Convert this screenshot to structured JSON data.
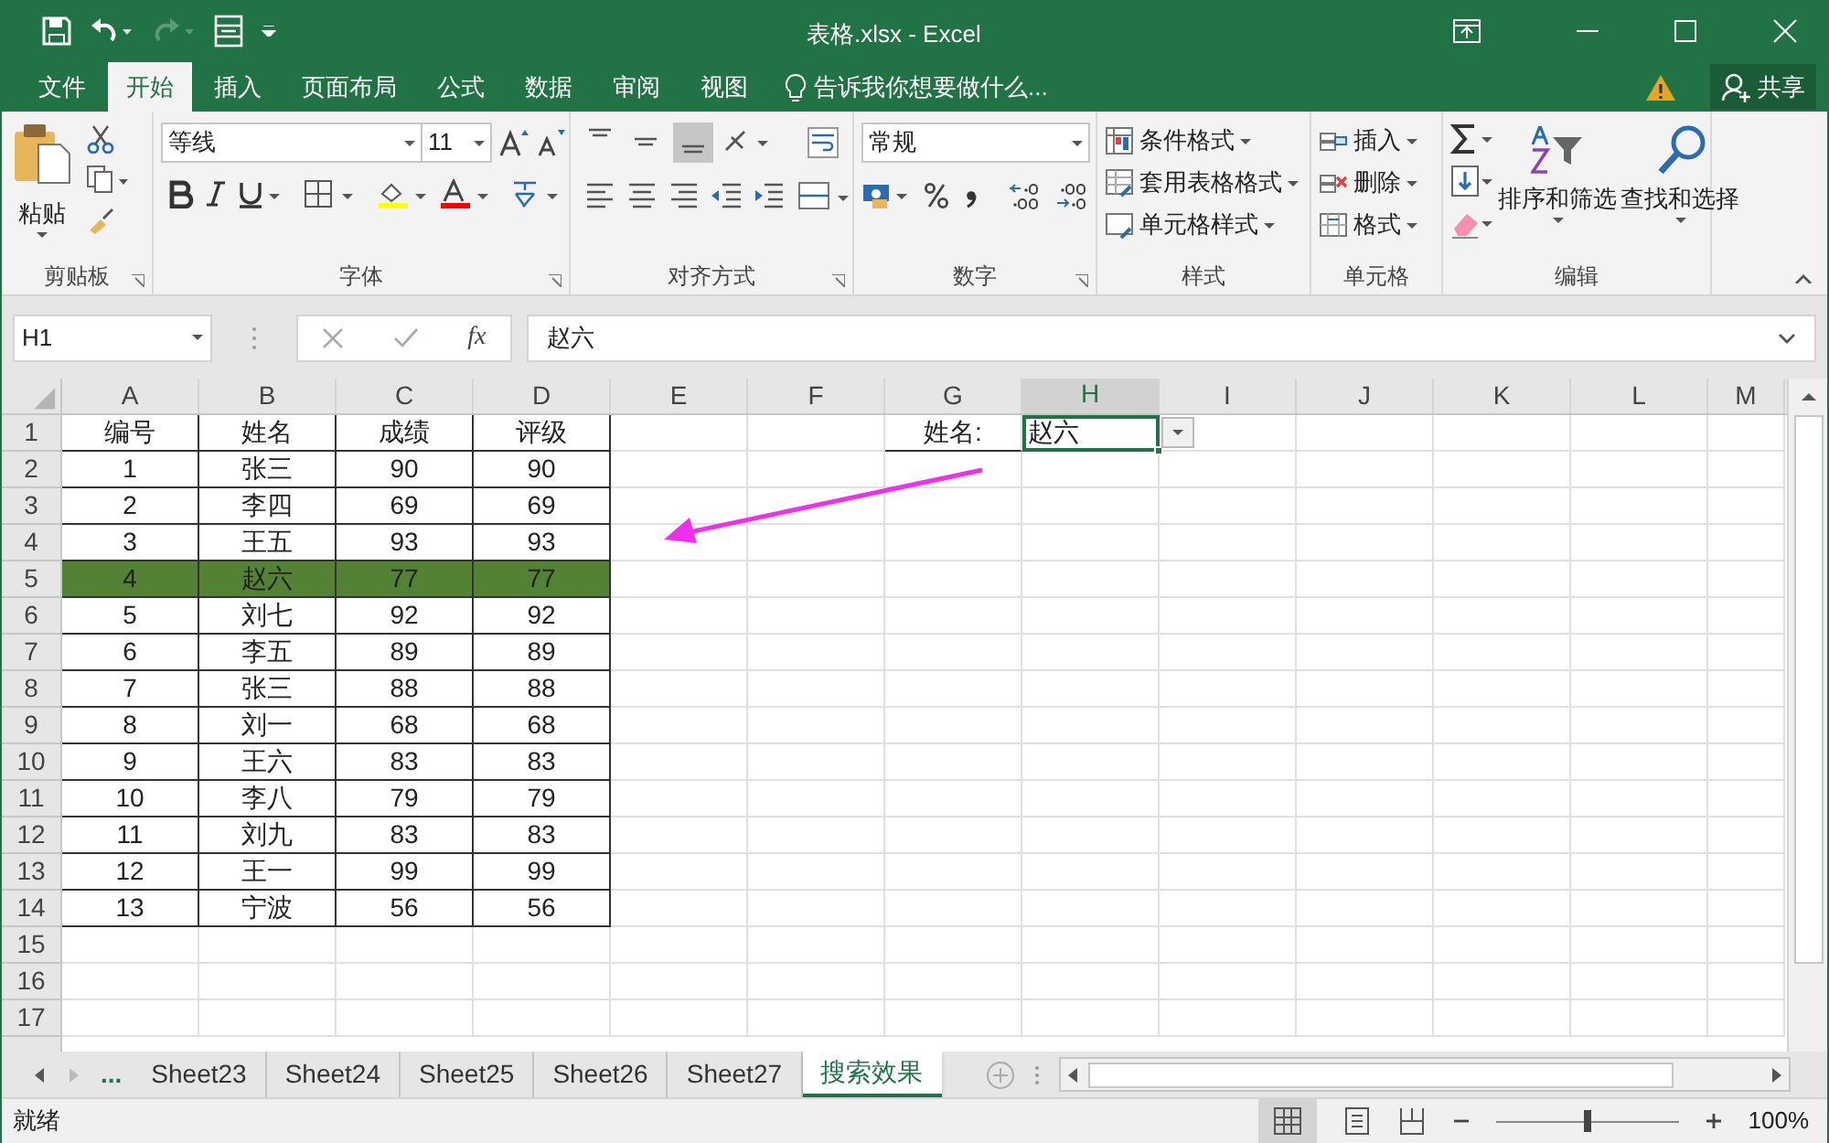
{
  "window": {
    "title": "表格.xlsx - Excel"
  },
  "ribbon_tabs": [
    {
      "label": "文件",
      "selected": false
    },
    {
      "label": "开始",
      "selected": true
    },
    {
      "label": "插入",
      "selected": false
    },
    {
      "label": "页面布局",
      "selected": false
    },
    {
      "label": "公式",
      "selected": false
    },
    {
      "label": "数据",
      "selected": false
    },
    {
      "label": "审阅",
      "selected": false
    },
    {
      "label": "视图",
      "selected": false
    }
  ],
  "tell_me": "告诉我你想要做什么...",
  "share": "共享",
  "ribbon": {
    "clipboard": {
      "label": "剪贴板",
      "paste": "粘贴"
    },
    "font": {
      "label": "字体",
      "font_name": "等线",
      "font_size": "11"
    },
    "alignment": {
      "label": "对齐方式"
    },
    "number": {
      "label": "数字",
      "format": "常规"
    },
    "styles": {
      "label": "样式",
      "items": [
        "条件格式",
        "套用表格格式",
        "单元格样式"
      ]
    },
    "cells": {
      "label": "单元格",
      "items": [
        "插入",
        "删除",
        "格式"
      ]
    },
    "editing": {
      "label": "编辑",
      "items": [
        "排序和筛选",
        "查找和选择"
      ]
    }
  },
  "formula_bar": {
    "name_box": "H1",
    "function_label": "fx",
    "content": "赵六"
  },
  "sheet": {
    "columns": [
      {
        "label": "A",
        "selected": false
      },
      {
        "label": "B",
        "selected": false
      },
      {
        "label": "C",
        "selected": false
      },
      {
        "label": "D",
        "selected": false
      },
      {
        "label": "E",
        "selected": false
      },
      {
        "label": "F",
        "selected": false
      },
      {
        "label": "G",
        "selected": false
      },
      {
        "label": "H",
        "selected": true
      },
      {
        "label": "I",
        "selected": false
      },
      {
        "label": "J",
        "selected": false
      },
      {
        "label": "K",
        "selected": false
      },
      {
        "label": "L",
        "selected": false
      },
      {
        "label": "M",
        "selected": false
      }
    ],
    "rows": [
      {
        "number": "1",
        "data": [
          "编号",
          "姓名",
          "成绩",
          "评级"
        ],
        "highlighted": false
      },
      {
        "number": "2",
        "data": [
          "1",
          "张三",
          "90",
          "90"
        ],
        "highlighted": false
      },
      {
        "number": "3",
        "data": [
          "2",
          "李四",
          "69",
          "69"
        ],
        "highlighted": false
      },
      {
        "number": "4",
        "data": [
          "3",
          "王五",
          "93",
          "93"
        ],
        "highlighted": false
      },
      {
        "number": "5",
        "data": [
          "4",
          "赵六",
          "77",
          "77"
        ],
        "highlighted": true
      },
      {
        "number": "6",
        "data": [
          "5",
          "刘七",
          "92",
          "92"
        ],
        "highlighted": false
      },
      {
        "number": "7",
        "data": [
          "6",
          "李五",
          "89",
          "89"
        ],
        "highlighted": false
      },
      {
        "number": "8",
        "data": [
          "7",
          "张三",
          "88",
          "88"
        ],
        "highlighted": false
      },
      {
        "number": "9",
        "data": [
          "8",
          "刘一",
          "68",
          "68"
        ],
        "highlighted": false
      },
      {
        "number": "10",
        "data": [
          "9",
          "王六",
          "83",
          "83"
        ],
        "highlighted": false
      },
      {
        "number": "11",
        "data": [
          "10",
          "李八",
          "79",
          "79"
        ],
        "highlighted": false
      },
      {
        "number": "12",
        "data": [
          "11",
          "刘九",
          "83",
          "83"
        ],
        "highlighted": false
      },
      {
        "number": "13",
        "data": [
          "12",
          "王一",
          "99",
          "99"
        ],
        "highlighted": false
      },
      {
        "number": "14",
        "data": [
          "13",
          "宁波",
          "56",
          "56"
        ],
        "highlighted": false
      },
      {
        "number": "15",
        "data": [],
        "highlighted": false
      },
      {
        "number": "16",
        "data": [],
        "highlighted": false
      },
      {
        "number": "17",
        "data": [],
        "highlighted": false
      }
    ],
    "lookup": {
      "label": "姓名:",
      "value": "赵六",
      "selected": true
    }
  },
  "sheet_tabs": [
    {
      "label": "...",
      "selected": false
    },
    {
      "label": "Sheet23",
      "selected": false
    },
    {
      "label": "Sheet24",
      "selected": false
    },
    {
      "label": "Sheet25",
      "selected": false
    },
    {
      "label": "Sheet26",
      "selected": false
    },
    {
      "label": "Sheet27",
      "selected": false
    },
    {
      "label": "搜索效果",
      "selected": true
    }
  ],
  "status_bar": {
    "status": "就绪",
    "zoom": "100%",
    "zoom_slider": {
      "level": 0.5
    }
  }
}
